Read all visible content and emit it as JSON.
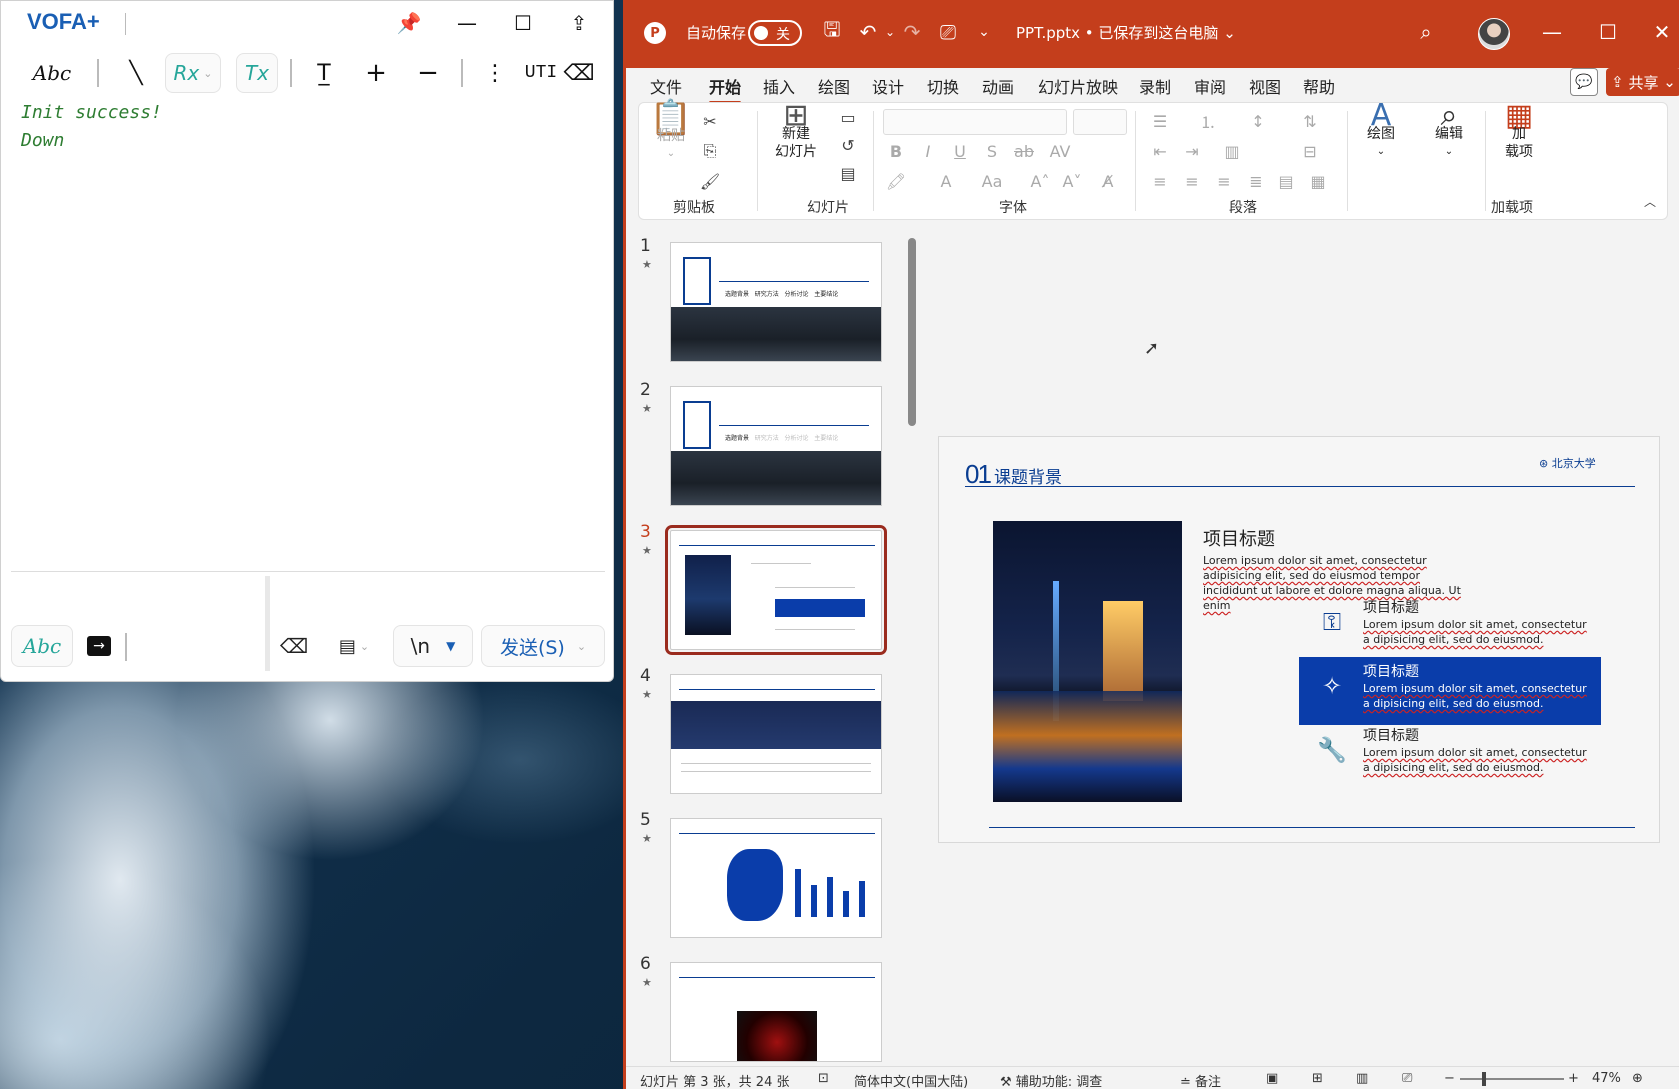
{
  "vofa": {
    "title": "VOFA+",
    "toolbar_abc": "Abc",
    "toolbar_rx": "Rx",
    "toolbar_tx": "Tx",
    "toolbar_uti": "UTI",
    "log_lines": [
      "Init success!",
      "Down"
    ],
    "bottom_abc": "Abc",
    "newline_value": "\\n",
    "send_label": "发送(S)"
  },
  "ppt": {
    "autosave_label": "自动保存",
    "autosave_state": "关",
    "file_title": "PPT.pptx • 已保存到这台电脑",
    "tabs": [
      "文件",
      "开始",
      "插入",
      "绘图",
      "设计",
      "切换",
      "动画",
      "幻灯片放映",
      "录制",
      "审阅",
      "视图",
      "帮助"
    ],
    "active_tab": "开始",
    "share_label": "共享",
    "ribbon": {
      "paste_label": "粘贴",
      "clipboard_group": "剪贴板",
      "new_slide_label": "新建\n幻灯片",
      "slides_group": "幻灯片",
      "font_group": "字体",
      "paragraph_group": "段落",
      "draw_label": "绘图",
      "edit_label": "编辑",
      "addin_label": "加\n载项",
      "addin_group": "加载项"
    },
    "thumbnails": [
      {
        "num": "1",
        "labels": [
          "选题背景",
          "研究方法",
          "分析讨论",
          "主要结论"
        ]
      },
      {
        "num": "2",
        "labels": [
          "选题背景",
          "研究方法",
          "分析讨论",
          "主要结论"
        ]
      },
      {
        "num": "3"
      },
      {
        "num": "4"
      },
      {
        "num": "5"
      },
      {
        "num": "6"
      }
    ],
    "selected_slide": "3",
    "slide": {
      "section_number": "01",
      "section_title": "课题背景",
      "university_logo": "北京大学",
      "main_title": "项目标题",
      "main_body": "Lorem ipsum dolor sit amet, consectetur adipisicing elit, sed do eiusmod tempor incididunt ut labore et dolore magna aliqua. Ut enim",
      "items": [
        {
          "title": "项目标题",
          "body": "Lorem ipsum dolor sit amet, consectetur a dipisicing elit, sed do eiusmod.",
          "icon": "key-icon"
        },
        {
          "title": "项目标题",
          "body": "Lorem ipsum dolor sit amet, consectetur a dipisicing elit, sed do eiusmod.",
          "icon": "magic-wand-icon"
        },
        {
          "title": "项目标题",
          "body": "Lorem ipsum dolor sit amet, consectetur a dipisicing elit, sed do eiusmod.",
          "icon": "wrench-icon"
        }
      ]
    },
    "status": {
      "slide_info": "幻灯片 第 3 张，共 24 张",
      "language": "简体中文(中国大陆)",
      "accessibility": "辅助功能: 调查",
      "notes": "备注",
      "zoom": "47%"
    },
    "colors": {
      "accent": "#c43e1c",
      "slide_blue": "#0a3d91",
      "highlight_blue": "#0a3daa"
    }
  }
}
